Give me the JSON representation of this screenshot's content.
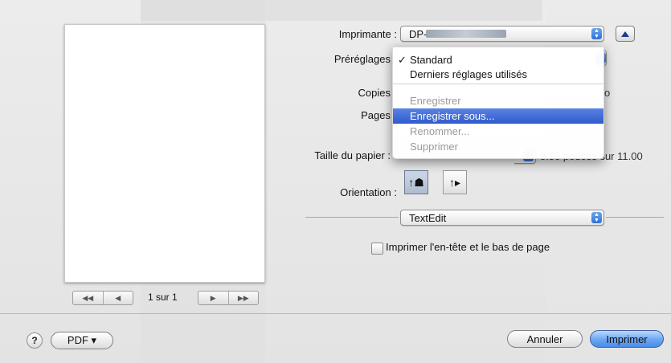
{
  "printer": {
    "label": "Imprimante :",
    "value": "DP-"
  },
  "presets": {
    "label": "Préréglages",
    "menu": {
      "items": [
        {
          "label": "Standard",
          "checked": true,
          "enabled": true
        },
        {
          "label": "Derniers réglages utilisés",
          "enabled": true
        },
        {
          "label": "Enregistrer",
          "enabled": false
        },
        {
          "label": "Enregistrer sous...",
          "enabled": true,
          "highlighted": true
        },
        {
          "label": "Renommer...",
          "enabled": false
        },
        {
          "label": "Supprimer",
          "enabled": false
        }
      ]
    }
  },
  "copies": {
    "label": "Copies",
    "recto_verso_fragment": "o"
  },
  "pages": {
    "label": "Pages"
  },
  "paper": {
    "label": "Taille du papier :",
    "size": "8.50 pouces sur 11.00"
  },
  "orientation": {
    "label": "Orientation :"
  },
  "app_section": {
    "value": "TextEdit"
  },
  "header_footer": {
    "label": "Imprimer l'en-tête et le bas de page",
    "checked": false
  },
  "preview": {
    "page_status": "1 sur 1"
  },
  "footer": {
    "help": "?",
    "pdf": "PDF ▾",
    "cancel": "Annuler",
    "print": "Imprimer"
  },
  "colors": {
    "accent": "#2f5ccb",
    "highlight": "#4a8ae8"
  }
}
